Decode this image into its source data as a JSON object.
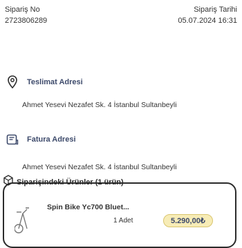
{
  "order": {
    "number_label": "Sipariş No",
    "number_value": "2723806289",
    "date_label": "Sipariş Tarihi",
    "date_value": "05.07.2024 16:31"
  },
  "shipping": {
    "title": "Teslimat Adresi",
    "address": "Ahmet Yesevi Nezafet Sk. 4 İstanbul Sultanbeyli",
    "icon": "location-pin-icon"
  },
  "billing": {
    "title": "Fatura Adresi",
    "address": "Ahmet Yesevi Nezafet Sk. 4 İstanbul Sultanbeyli",
    "icon": "invoice-icon"
  },
  "cart": {
    "title": "Siparişindeki Ürünler (1 ürün)",
    "icon": "box-icon",
    "items": [
      {
        "name": "Spin Bike Yc700 Bluet...",
        "quantity": "1 Adet",
        "price": "5.290,00₺",
        "icon": "spin-bike-icon"
      }
    ]
  },
  "colors": {
    "accent": "#3d4a6b",
    "price_bg": "#f7ecb6"
  }
}
